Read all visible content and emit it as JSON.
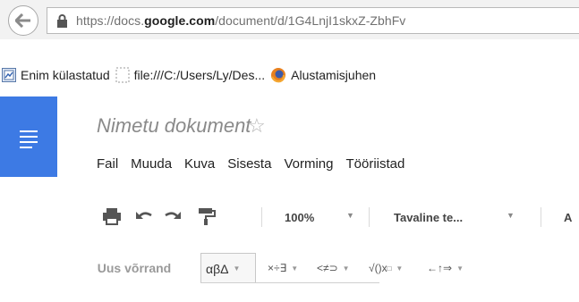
{
  "browser": {
    "url_prefix": "https://docs.",
    "url_domain": "google.com",
    "url_path": "/document/d/1G4LnjI1skxZ-ZbhFv",
    "bookmarks": [
      {
        "label": "Enim külastatud",
        "icon": "most-visited-icon"
      },
      {
        "label": "file:///C:/Users/Ly/Des...",
        "icon": "blank-page-icon"
      },
      {
        "label": "Alustamisjuhen",
        "icon": "firefox-icon"
      }
    ]
  },
  "doc": {
    "title": "Nimetu dokument",
    "star": "☆",
    "menu": [
      "Fail",
      "Muuda",
      "Kuva",
      "Sisesta",
      "Vorming",
      "Tööriistad"
    ]
  },
  "toolbar": {
    "zoom": "100%",
    "style": "Tavaline te...",
    "font_initial": "A"
  },
  "equation": {
    "new_equation": "Uus võrrand",
    "greek": "αβΔ",
    "ops": "×÷∃",
    "relations": "<≠⊃",
    "math": "√()x",
    "arrows": "←↑⇒"
  },
  "colors": {
    "docs_blue": "#3d7ae4",
    "address_bg": "#f2f2f2"
  }
}
